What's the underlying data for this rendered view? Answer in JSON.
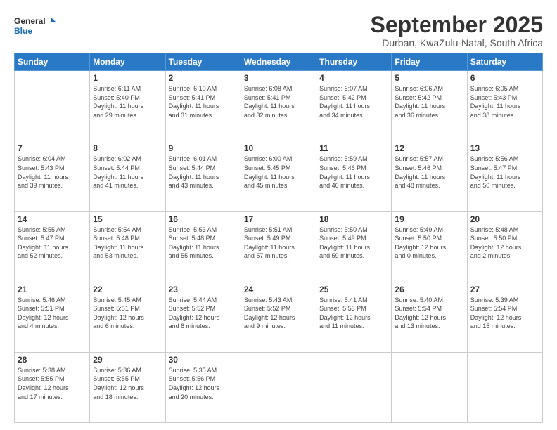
{
  "logo": {
    "line1": "General",
    "line2": "Blue"
  },
  "title": "September 2025",
  "location": "Durban, KwaZulu-Natal, South Africa",
  "weekdays": [
    "Sunday",
    "Monday",
    "Tuesday",
    "Wednesday",
    "Thursday",
    "Friday",
    "Saturday"
  ],
  "weeks": [
    [
      {
        "day": "",
        "info": ""
      },
      {
        "day": "1",
        "info": "Sunrise: 6:11 AM\nSunset: 5:40 PM\nDaylight: 11 hours\nand 29 minutes."
      },
      {
        "day": "2",
        "info": "Sunrise: 6:10 AM\nSunset: 5:41 PM\nDaylight: 11 hours\nand 31 minutes."
      },
      {
        "day": "3",
        "info": "Sunrise: 6:08 AM\nSunset: 5:41 PM\nDaylight: 11 hours\nand 32 minutes."
      },
      {
        "day": "4",
        "info": "Sunrise: 6:07 AM\nSunset: 5:42 PM\nDaylight: 11 hours\nand 34 minutes."
      },
      {
        "day": "5",
        "info": "Sunrise: 6:06 AM\nSunset: 5:42 PM\nDaylight: 11 hours\nand 36 minutes."
      },
      {
        "day": "6",
        "info": "Sunrise: 6:05 AM\nSunset: 5:43 PM\nDaylight: 11 hours\nand 38 minutes."
      }
    ],
    [
      {
        "day": "7",
        "info": "Sunrise: 6:04 AM\nSunset: 5:43 PM\nDaylight: 11 hours\nand 39 minutes."
      },
      {
        "day": "8",
        "info": "Sunrise: 6:02 AM\nSunset: 5:44 PM\nDaylight: 11 hours\nand 41 minutes."
      },
      {
        "day": "9",
        "info": "Sunrise: 6:01 AM\nSunset: 5:44 PM\nDaylight: 11 hours\nand 43 minutes."
      },
      {
        "day": "10",
        "info": "Sunrise: 6:00 AM\nSunset: 5:45 PM\nDaylight: 11 hours\nand 45 minutes."
      },
      {
        "day": "11",
        "info": "Sunrise: 5:59 AM\nSunset: 5:46 PM\nDaylight: 11 hours\nand 46 minutes."
      },
      {
        "day": "12",
        "info": "Sunrise: 5:57 AM\nSunset: 5:46 PM\nDaylight: 11 hours\nand 48 minutes."
      },
      {
        "day": "13",
        "info": "Sunrise: 5:56 AM\nSunset: 5:47 PM\nDaylight: 11 hours\nand 50 minutes."
      }
    ],
    [
      {
        "day": "14",
        "info": "Sunrise: 5:55 AM\nSunset: 5:47 PM\nDaylight: 11 hours\nand 52 minutes."
      },
      {
        "day": "15",
        "info": "Sunrise: 5:54 AM\nSunset: 5:48 PM\nDaylight: 11 hours\nand 53 minutes."
      },
      {
        "day": "16",
        "info": "Sunrise: 5:53 AM\nSunset: 5:48 PM\nDaylight: 11 hours\nand 55 minutes."
      },
      {
        "day": "17",
        "info": "Sunrise: 5:51 AM\nSunset: 5:49 PM\nDaylight: 11 hours\nand 57 minutes."
      },
      {
        "day": "18",
        "info": "Sunrise: 5:50 AM\nSunset: 5:49 PM\nDaylight: 11 hours\nand 59 minutes."
      },
      {
        "day": "19",
        "info": "Sunrise: 5:49 AM\nSunset: 5:50 PM\nDaylight: 12 hours\nand 0 minutes."
      },
      {
        "day": "20",
        "info": "Sunrise: 5:48 AM\nSunset: 5:50 PM\nDaylight: 12 hours\nand 2 minutes."
      }
    ],
    [
      {
        "day": "21",
        "info": "Sunrise: 5:46 AM\nSunset: 5:51 PM\nDaylight: 12 hours\nand 4 minutes."
      },
      {
        "day": "22",
        "info": "Sunrise: 5:45 AM\nSunset: 5:51 PM\nDaylight: 12 hours\nand 6 minutes."
      },
      {
        "day": "23",
        "info": "Sunrise: 5:44 AM\nSunset: 5:52 PM\nDaylight: 12 hours\nand 8 minutes."
      },
      {
        "day": "24",
        "info": "Sunrise: 5:43 AM\nSunset: 5:52 PM\nDaylight: 12 hours\nand 9 minutes."
      },
      {
        "day": "25",
        "info": "Sunrise: 5:41 AM\nSunset: 5:53 PM\nDaylight: 12 hours\nand 11 minutes."
      },
      {
        "day": "26",
        "info": "Sunrise: 5:40 AM\nSunset: 5:54 PM\nDaylight: 12 hours\nand 13 minutes."
      },
      {
        "day": "27",
        "info": "Sunrise: 5:39 AM\nSunset: 5:54 PM\nDaylight: 12 hours\nand 15 minutes."
      }
    ],
    [
      {
        "day": "28",
        "info": "Sunrise: 5:38 AM\nSunset: 5:55 PM\nDaylight: 12 hours\nand 17 minutes."
      },
      {
        "day": "29",
        "info": "Sunrise: 5:36 AM\nSunset: 5:55 PM\nDaylight: 12 hours\nand 18 minutes."
      },
      {
        "day": "30",
        "info": "Sunrise: 5:35 AM\nSunset: 5:56 PM\nDaylight: 12 hours\nand 20 minutes."
      },
      {
        "day": "",
        "info": ""
      },
      {
        "day": "",
        "info": ""
      },
      {
        "day": "",
        "info": ""
      },
      {
        "day": "",
        "info": ""
      }
    ]
  ]
}
